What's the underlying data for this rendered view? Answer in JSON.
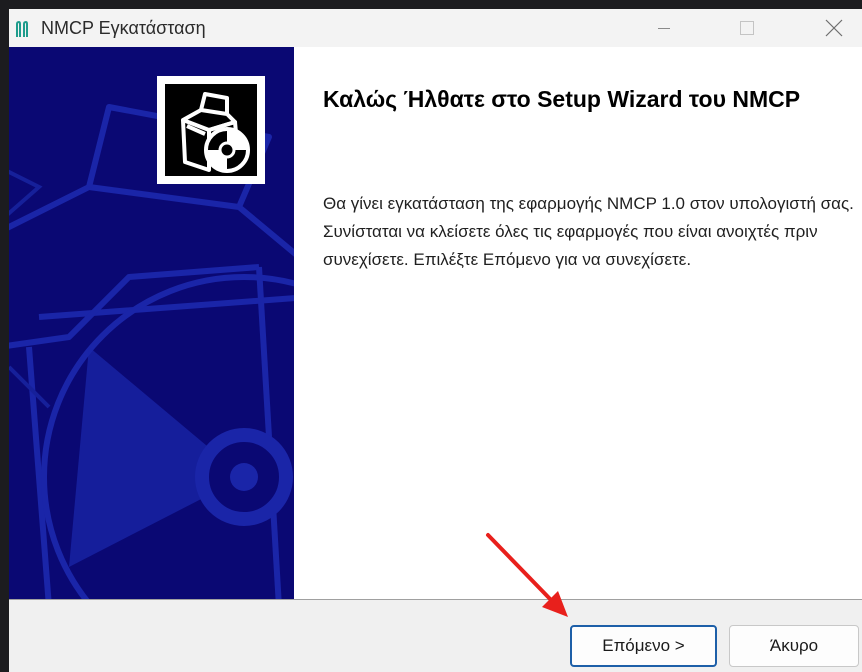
{
  "window": {
    "title": "NMCP Εγκατάσταση"
  },
  "welcome": {
    "heading": "Καλώς Ήλθατε στο Setup Wizard του NMCP",
    "description": "Θα γίνει εγκατάσταση της εφαρμογής NMCP 1.0 στον υπολογιστή σας. Συνίσταται να κλείσετε όλες τις εφαρμογές που είναι ανοιχτές πριν συνεχίσετε. Επιλέξτε Επόμενο για να συνεχίσετε."
  },
  "buttons": {
    "next_label": "Επόμενο >",
    "cancel_label": "Άκυρο"
  },
  "colors": {
    "side_panel": "#0a0873",
    "accent_border": "#1d5fa8",
    "annotation_arrow": "#e8201c",
    "app_icon": "#1e9c8c"
  },
  "icons": {
    "app": "nmcp-app-icon",
    "wizard": "box-and-disc-icon",
    "minimize": "minimize-icon",
    "maximize": "maximize-icon",
    "close": "close-icon"
  }
}
